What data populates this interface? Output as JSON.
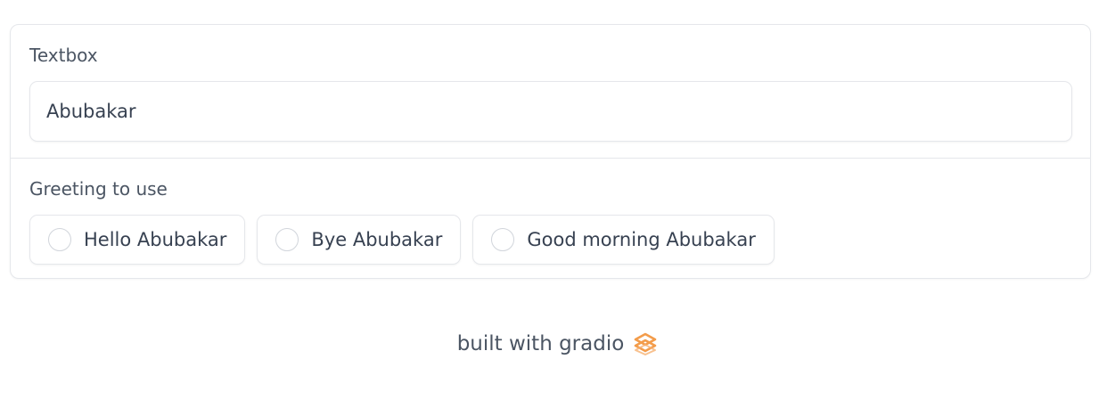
{
  "textbox": {
    "label": "Textbox",
    "value": "Abubakar"
  },
  "radio": {
    "label": "Greeting to use",
    "options": [
      {
        "label": "Hello Abubakar",
        "selected": false
      },
      {
        "label": "Bye Abubakar",
        "selected": false
      },
      {
        "label": "Good morning Abubakar",
        "selected": false
      }
    ]
  },
  "footer": {
    "text": "built with gradio",
    "logo_icon": "gradio-logo-icon",
    "logo_color": "#f39c4a"
  }
}
